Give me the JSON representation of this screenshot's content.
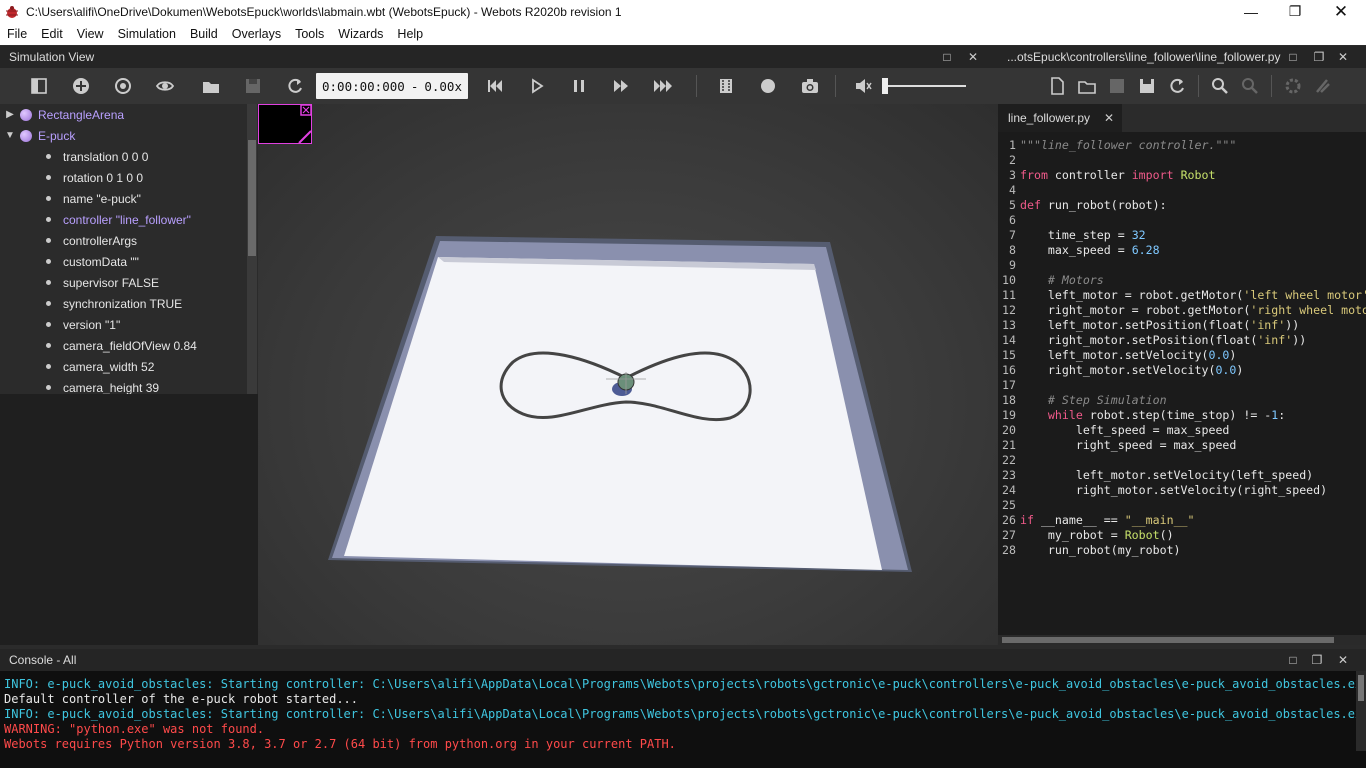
{
  "window": {
    "title": "C:\\Users\\alifi\\OneDrive\\Dokumen\\WebotsEpuck\\worlds\\labmain.wbt (WebotsEpuck) - Webots R2020b revision 1"
  },
  "menu": [
    "File",
    "Edit",
    "View",
    "Simulation",
    "Build",
    "Overlays",
    "Tools",
    "Wizards",
    "Help"
  ],
  "simulation_view": {
    "title": "Simulation View",
    "time": "0:00:00:000",
    "time_sep": "-",
    "speed": "0.00x"
  },
  "scene_tree": [
    {
      "label": "RectangleArena",
      "type": "node",
      "expanded": false
    },
    {
      "label": "E-puck",
      "type": "node",
      "expanded": true
    },
    {
      "label": "translation 0 0 0",
      "type": "field"
    },
    {
      "label": "rotation 0 1 0 0",
      "type": "field"
    },
    {
      "label": "name \"e-puck\"",
      "type": "field"
    },
    {
      "label": "controller \"line_follower\"",
      "type": "field",
      "highlight": true
    },
    {
      "label": "controllerArgs",
      "type": "field"
    },
    {
      "label": "customData \"\"",
      "type": "field"
    },
    {
      "label": "supervisor FALSE",
      "type": "field"
    },
    {
      "label": "synchronization TRUE",
      "type": "field"
    },
    {
      "label": "version \"1\"",
      "type": "field"
    },
    {
      "label": "camera_fieldOfView 0.84",
      "type": "field"
    },
    {
      "label": "camera_width 52",
      "type": "field"
    },
    {
      "label": "camera_height 39",
      "type": "field"
    }
  ],
  "editor": {
    "title": "...otsEpuck\\controllers\\line_follower\\line_follower.py",
    "tab": "line_follower.py",
    "lines": [
      "\"\"\"line_follower controller.\"\"\"",
      "",
      "from controller import Robot",
      "",
      "def run_robot(robot):",
      "",
      "    time_step = 32",
      "    max_speed = 6.28",
      "",
      "    # Motors",
      "    left_motor = robot.getMotor('left wheel motor')",
      "    right_motor = robot.getMotor('right wheel motor')",
      "    left_motor.setPosition(float('inf'))",
      "    right_motor.setPosition(float('inf'))",
      "    left_motor.setVelocity(0.0)",
      "    right_motor.setVelocity(0.0)",
      "",
      "    # Step Simulation",
      "    while robot.step(time_stop) != -1:",
      "        left_speed = max_speed",
      "        right_speed = max_speed",
      "",
      "        left_motor.setVelocity(left_speed)",
      "        right_motor.setVelocity(right_speed)",
      "",
      "if __name__ == \"__main__\"",
      "    my_robot = Robot()",
      "    run_robot(my_robot)"
    ]
  },
  "console": {
    "title": "Console - All",
    "lines": [
      {
        "text": "INFO: e-puck_avoid_obstacles: Starting controller: C:\\Users\\alifi\\AppData\\Local\\Programs\\Webots\\projects\\robots\\gctronic\\e-puck\\controllers\\e-puck_avoid_obstacles\\e-puck_avoid_obstacles.exe",
        "color": "#3fc6e0"
      },
      {
        "text": "Default controller of the e-puck robot started...",
        "color": "#e8e8e8"
      },
      {
        "text": "INFO: e-puck_avoid_obstacles: Starting controller: C:\\Users\\alifi\\AppData\\Local\\Programs\\Webots\\projects\\robots\\gctronic\\e-puck\\controllers\\e-puck_avoid_obstacles\\e-puck_avoid_obstacles.exe",
        "color": "#3fc6e0"
      },
      {
        "text": "WARNING: \"python.exe\" was not found.",
        "color": "#ff4a4a"
      },
      {
        "text": "Webots requires Python version 3.8, 3.7 or 2.7 (64 bit) from python.org in your current PATH.",
        "color": "#ff4a4a"
      }
    ]
  },
  "colors": {
    "accent": "#b9a0ff",
    "info": "#3fc6e0",
    "warning": "#ff4a4a"
  }
}
